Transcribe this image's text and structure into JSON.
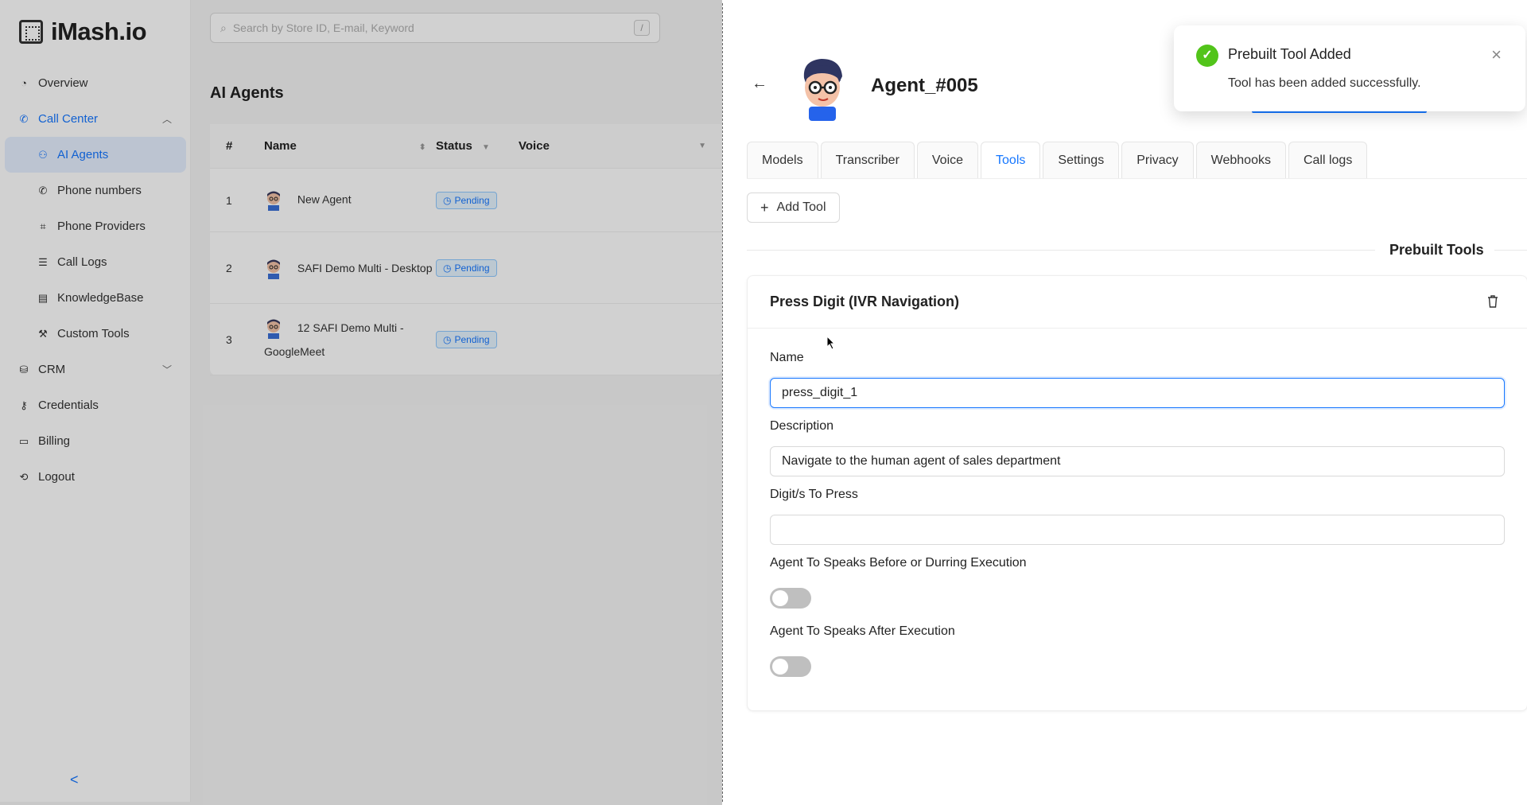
{
  "app": {
    "brand": "iMash.io",
    "search_placeholder": "Search by Store ID, E-mail, Keyword",
    "search_shortcut": "/",
    "page_title": "AI Agents"
  },
  "sidebar": {
    "items": [
      {
        "label": "Overview",
        "icon": "dashboard-icon"
      },
      {
        "label": "Call Center",
        "icon": "phone-icon",
        "expanded": true
      },
      {
        "label": "AI Agents",
        "icon": "user-icon",
        "active": true
      },
      {
        "label": "Phone numbers",
        "icon": "phone-icon"
      },
      {
        "label": "Phone Providers",
        "icon": "provider-icon"
      },
      {
        "label": "Call Logs",
        "icon": "list-icon"
      },
      {
        "label": "KnowledgeBase",
        "icon": "file-icon"
      },
      {
        "label": "Custom Tools",
        "icon": "tool-icon"
      },
      {
        "label": "CRM",
        "icon": "database-icon"
      },
      {
        "label": "Credentials",
        "icon": "key-icon"
      },
      {
        "label": "Billing",
        "icon": "card-icon"
      },
      {
        "label": "Logout",
        "icon": "logout-icon"
      }
    ],
    "collapse_label": "<"
  },
  "table": {
    "columns": [
      "#",
      "Name",
      "Status",
      "Voice"
    ],
    "rows": [
      {
        "num": "1",
        "name": "New Agent",
        "status": "Pending"
      },
      {
        "num": "2",
        "name": "SAFI Demo Multi - Desktop",
        "status": "Pending"
      },
      {
        "num": "3",
        "name": "12 SAFI Demo Multi - GoogleMeet",
        "status": "Pending"
      }
    ]
  },
  "drawer": {
    "agent_name": "Agent_#005",
    "tabs": [
      "Models",
      "Transcriber",
      "Voice",
      "Tools",
      "Settings",
      "Privacy",
      "Webhooks",
      "Call logs"
    ],
    "active_tab": "Tools",
    "add_tool_label": "Add Tool",
    "section_title": "Prebuilt Tools",
    "tool": {
      "title": "Press Digit (IVR Navigation)",
      "name_label": "Name",
      "name_value": "press_digit_1",
      "description_label": "Description",
      "description_value": "Navigate to the human agent of sales department",
      "digits_label": "Digit/s To Press",
      "digits_value": "",
      "speak_before_label": "Agent To Speaks Before or Durring Execution",
      "speak_before_on": false,
      "speak_after_label": "Agent To Speaks After Execution",
      "speak_after_on": false
    }
  },
  "toast": {
    "title": "Prebuilt Tool Added",
    "message": "Tool has been added successfully."
  },
  "colors": {
    "accent": "#1677ff",
    "success": "#52c41a"
  }
}
